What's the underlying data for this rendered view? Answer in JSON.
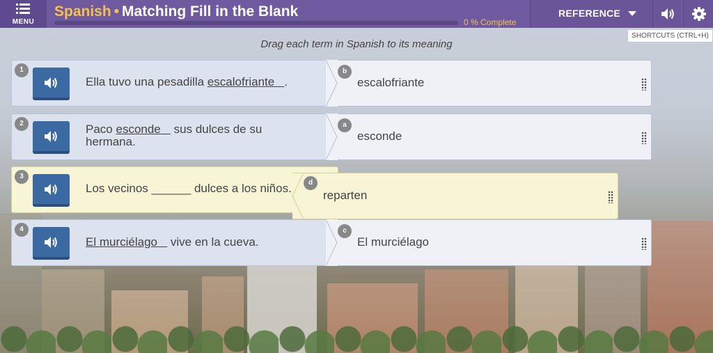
{
  "header": {
    "menu_label": "MENU",
    "subject": "Spanish",
    "separator": "•",
    "activity_title": "Matching Fill in the Blank",
    "progress_text": "0 % Complete",
    "progress_fraction": 0,
    "reference_label": "REFERENCE",
    "shortcuts_label": "SHORTCUTS (CTRL+H)"
  },
  "instructions": "Drag each term in Spanish to its meaning",
  "rows": [
    {
      "number": "1",
      "before": "Ella tuvo una pesadilla ",
      "blank": "escalofriante   ",
      "after": ".",
      "card_letter": "b",
      "card_text": "escalofriante"
    },
    {
      "number": "2",
      "before": "Paco ",
      "blank": "esconde   ",
      "after": " sus dulces de su hermana.",
      "card_letter": "a",
      "card_text": "esconde"
    },
    {
      "number": "3",
      "before": "Los vecinos ______ dulces a los niños.",
      "blank": "",
      "after": "",
      "card_letter": "d",
      "card_text": "reparten"
    },
    {
      "number": "4",
      "before": "",
      "blank": "El murciélago   ",
      "after": " vive en la cueva.",
      "card_letter": "c",
      "card_text": "El murciélago"
    }
  ],
  "colors": {
    "header_bg": "#6f5aa0",
    "accent": "#f4c04e",
    "speaker_button": "#3b6aa3",
    "active_row": "#f8f4d6"
  },
  "icons": {
    "menu": "menu-icon",
    "speaker": "speaker-icon",
    "volume": "volume-icon",
    "settings": "gear-icon",
    "caret": "chevron-down-icon",
    "drag": "drag-handle-icon"
  }
}
